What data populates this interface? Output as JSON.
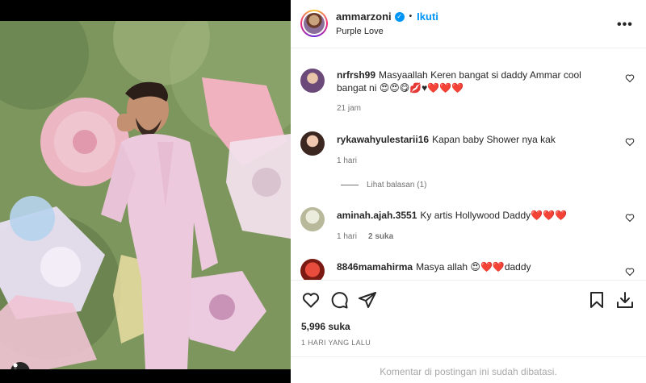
{
  "post": {
    "username": "ammarzoni",
    "verified_icon": "verified-badge-icon",
    "separator": "•",
    "follow_label": "Ikuti",
    "audio_or_location": "Purple Love",
    "more_icon": "more-options-icon",
    "more_label": "•••"
  },
  "comments": [
    {
      "username": "nrfrsh99",
      "text": "Masyaallah Keren bangat si daddy Ammar cool bangat ni 😍😍😋💋♥❤️❤️❤️",
      "time": "21 jam",
      "likes": "",
      "avatar_color": "#6b4a7a"
    },
    {
      "username": "rykawahyulestarii16",
      "text": "Kapan baby Shower nya kak",
      "time": "1 hari",
      "likes": "",
      "replies_label": "Lihat balasan (1)",
      "avatar_color": "#b0796a"
    },
    {
      "username": "aminah.ajah.3551",
      "text": "Ky artis Hollywood Daddy❤️❤️❤️",
      "time": "1 hari",
      "likes": "2 suka",
      "avatar_color": "#c9c9b0"
    },
    {
      "username": "8846mamahirma",
      "text": "Masya allah 😍❤️❤️daddy",
      "time": "",
      "likes": "",
      "avatar_color": "#c0392b"
    }
  ],
  "actions": {
    "like_icon": "heart-icon",
    "comment_icon": "comment-icon",
    "share_icon": "share-icon",
    "save_icon": "bookmark-icon",
    "download_icon": "download-icon"
  },
  "likes_count": "5,996 suka",
  "time_ago": "1 HARI YANG LALU",
  "comments_disabled": "Komentar di postingan ini sudah dibatasi.",
  "colors": {
    "accent": "#0095f6",
    "text": "#262626",
    "secondary": "#737373",
    "muted": "#a8a8a8"
  }
}
